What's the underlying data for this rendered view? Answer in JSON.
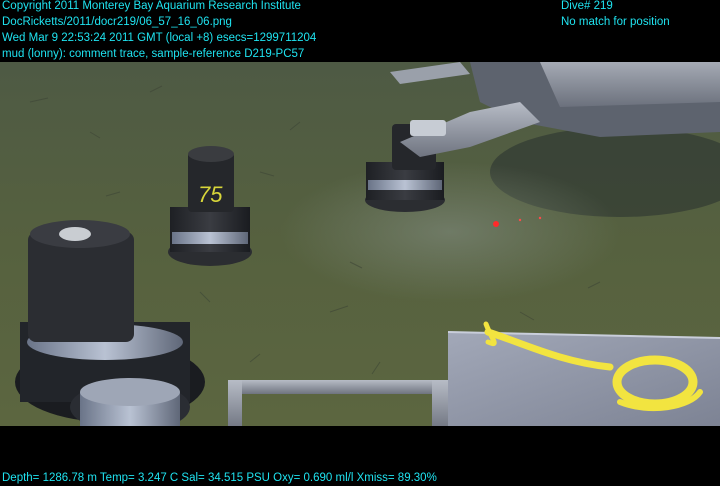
{
  "overlay": {
    "color": "#1fe3f0",
    "header_left": [
      "Copyright 2011 Monterey Bay Aquarium Research Institute",
      "DocRicketts/2011/docr219/06_57_16_06.png",
      "Wed Mar  9 22:53:24 2011 GMT (local +8)  esecs=1299711204",
      "mud (lonny): comment trace, sample-reference D219-PC57"
    ],
    "header_right": [
      "Dive# 219",
      "No match for position"
    ],
    "footer": "Depth= 1286.78 m  Temp= 3.247 C  Sal= 34.515 PSU  Oxy= 0.690 ml/l  Xmiss= 89.30%"
  },
  "scene": {
    "core_label": "75"
  }
}
